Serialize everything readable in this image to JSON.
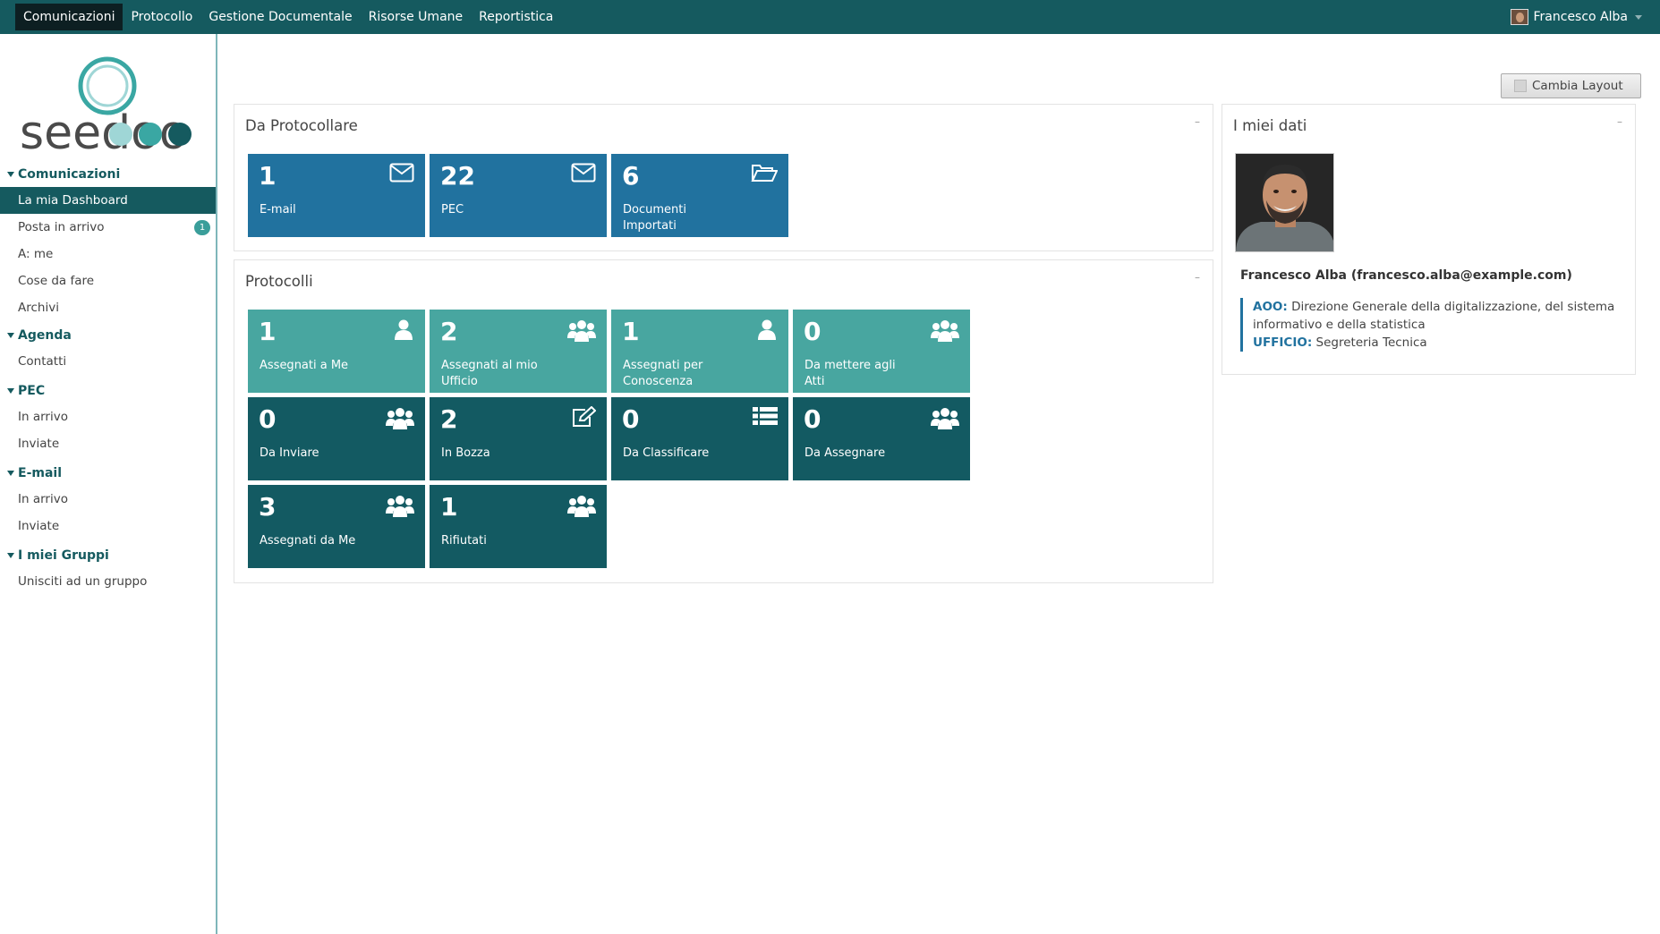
{
  "topnav": {
    "items": [
      {
        "label": "Comunicazioni",
        "active": true
      },
      {
        "label": "Protocollo"
      },
      {
        "label": "Gestione Documentale"
      },
      {
        "label": "Risorse Umane"
      },
      {
        "label": "Reportistica"
      }
    ],
    "user_name": "Francesco Alba"
  },
  "logo_text": "seedoo",
  "sidebar": {
    "sections": [
      {
        "title": "Comunicazioni",
        "items": [
          {
            "label": "La mia Dashboard",
            "active": true
          },
          {
            "label": "Posta in arrivo",
            "badge": "1"
          },
          {
            "label": "A: me"
          },
          {
            "label": "Cose da fare"
          },
          {
            "label": "Archivi"
          }
        ]
      },
      {
        "title": "Agenda",
        "items": [
          {
            "label": "Contatti"
          }
        ]
      },
      {
        "title": "PEC",
        "items": [
          {
            "label": "In arrivo"
          },
          {
            "label": "Inviate"
          }
        ]
      },
      {
        "title": "E-mail",
        "items": [
          {
            "label": "In arrivo"
          },
          {
            "label": "Inviate"
          }
        ]
      },
      {
        "title": "I miei Gruppi",
        "items": [
          {
            "label": "Unisciti ad un gruppo"
          }
        ]
      }
    ]
  },
  "layout_button": {
    "label": "Cambia Layout"
  },
  "da_protocollare": {
    "title": "Da Protocollare",
    "minimize": "–",
    "tiles": [
      {
        "count": "1",
        "label": "E-mail",
        "icon": "envelope-icon",
        "color": "#21729f"
      },
      {
        "count": "22",
        "label": "PEC",
        "icon": "envelope-icon",
        "color": "#21729f"
      },
      {
        "count": "6",
        "label": "Documenti Importati",
        "icon": "folder-open-icon",
        "color": "#21729f"
      }
    ]
  },
  "protocolli": {
    "title": "Protocolli",
    "minimize": "–",
    "tiles": [
      {
        "count": "1",
        "label": "Assegnati a Me",
        "icon": "user-icon",
        "color": "#48a6a0"
      },
      {
        "count": "2",
        "label": "Assegnati al mio Ufficio",
        "icon": "users-icon",
        "color": "#48a6a0"
      },
      {
        "count": "1",
        "label": "Assegnati per Conoscenza",
        "icon": "user-icon",
        "color": "#48a6a0"
      },
      {
        "count": "0",
        "label": "Da mettere agli Atti",
        "icon": "users-icon",
        "color": "#48a6a0"
      },
      {
        "count": "0",
        "label": "Da Inviare",
        "icon": "users-icon",
        "color": "#135a62"
      },
      {
        "count": "2",
        "label": "In Bozza",
        "icon": "edit-icon",
        "color": "#135a62"
      },
      {
        "count": "0",
        "label": "Da Classificare",
        "icon": "list-icon",
        "color": "#135a62"
      },
      {
        "count": "0",
        "label": "Da Assegnare",
        "icon": "users-icon",
        "color": "#135a62"
      },
      {
        "count": "3",
        "label": "Assegnati da Me",
        "icon": "users-icon",
        "color": "#135a62"
      },
      {
        "count": "1",
        "label": "Rifiutati",
        "icon": "users-icon",
        "color": "#135a62"
      }
    ]
  },
  "miei_dati": {
    "title": "I miei dati",
    "minimize": "–",
    "name_line": "Francesco Alba (francesco.alba@example.com)",
    "aoo_key": "AOO:",
    "aoo_value": "Direzione Generale della digitalizzazione, del sistema informativo e della statistica",
    "ufficio_key": "UFFICIO:",
    "ufficio_value": "Segreteria Tecnica"
  }
}
